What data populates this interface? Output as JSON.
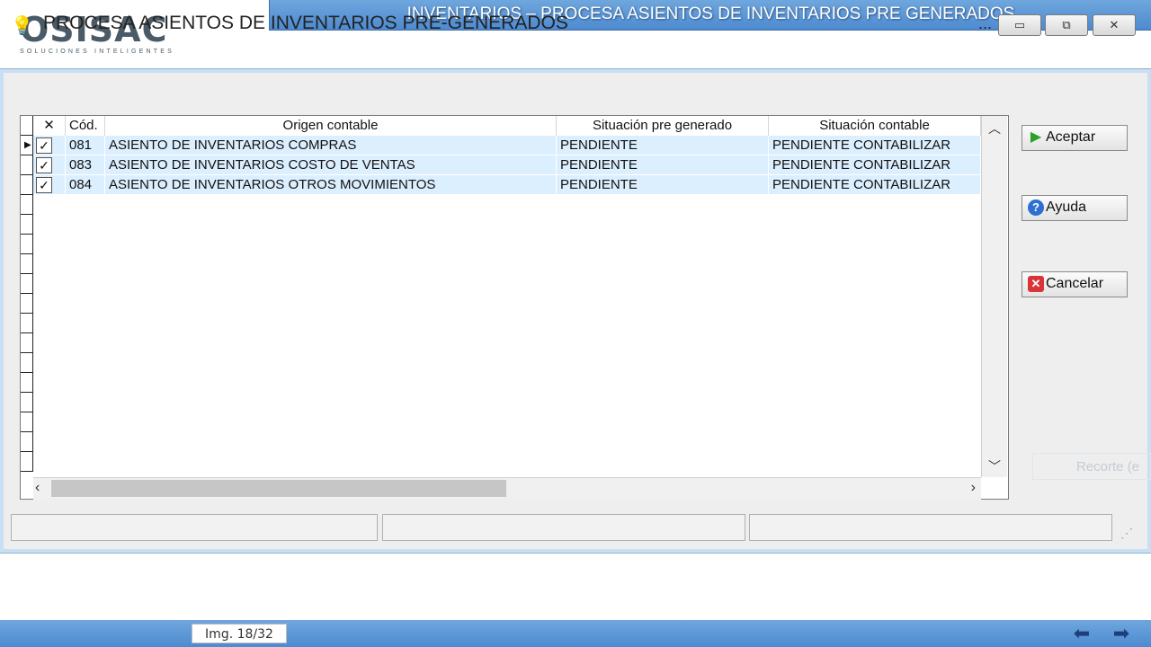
{
  "brand": {
    "logo_text": "OSISAC",
    "tagline": "SOLUCIONES INTELIGENTES"
  },
  "banner": {
    "title": "INVENTARIOS – PROCESA ASIENTOS DE INVENTARIOS PRE GENERADOS"
  },
  "window": {
    "title": "PROCESA ASIENTOS DE INVENTARIOS PRE-GENERADOS",
    "menu_dots": "...",
    "minimize": "▭",
    "maximize": "⧉",
    "close": "✕"
  },
  "grid": {
    "columns": {
      "check": "✕",
      "code": "Cód.",
      "origin": "Origen contable",
      "pre_status": "Situación pre generado",
      "acc_status": "Situación contable"
    },
    "rows": [
      {
        "checked": "✓",
        "code": "081",
        "origin": "ASIENTO DE INVENTARIOS COMPRAS",
        "pre_status": "PENDIENTE",
        "acc_status": "PENDIENTE CONTABILIZAR"
      },
      {
        "checked": "✓",
        "code": "083",
        "origin": "ASIENTO DE INVENTARIOS COSTO DE VENTAS",
        "pre_status": "PENDIENTE",
        "acc_status": "PENDIENTE CONTABILIZAR"
      },
      {
        "checked": "✓",
        "code": "084",
        "origin": "ASIENTO DE INVENTARIOS OTROS MOVIMIENTOS",
        "pre_status": "PENDIENTE",
        "acc_status": "PENDIENTE CONTABILIZAR"
      }
    ]
  },
  "buttons": {
    "accept": "Aceptar",
    "help": "Ayuda",
    "cancel": "Cancelar"
  },
  "ghost_label": "Recorte (e",
  "footer": {
    "page": "Img. 18/32"
  }
}
